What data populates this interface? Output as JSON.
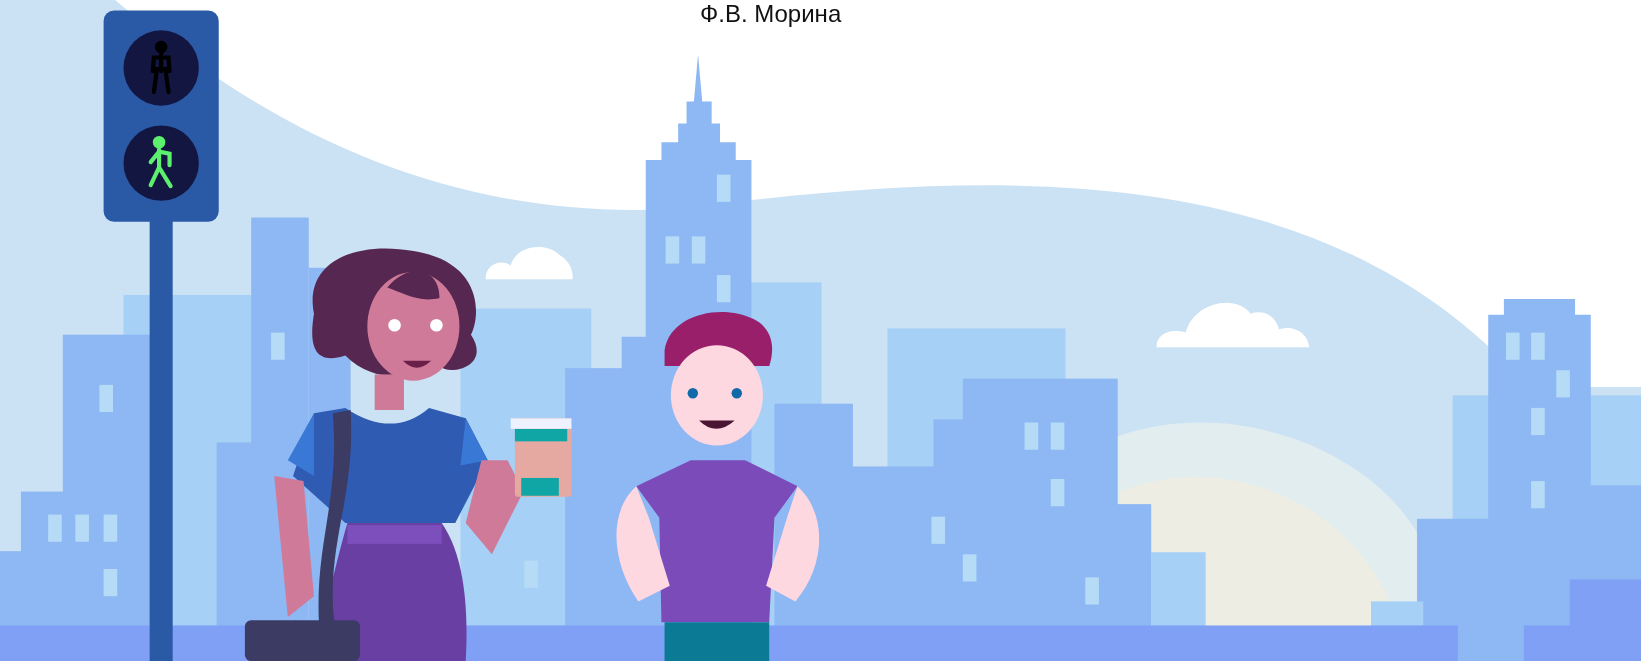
{
  "author": "Ф.В. Морина"
}
